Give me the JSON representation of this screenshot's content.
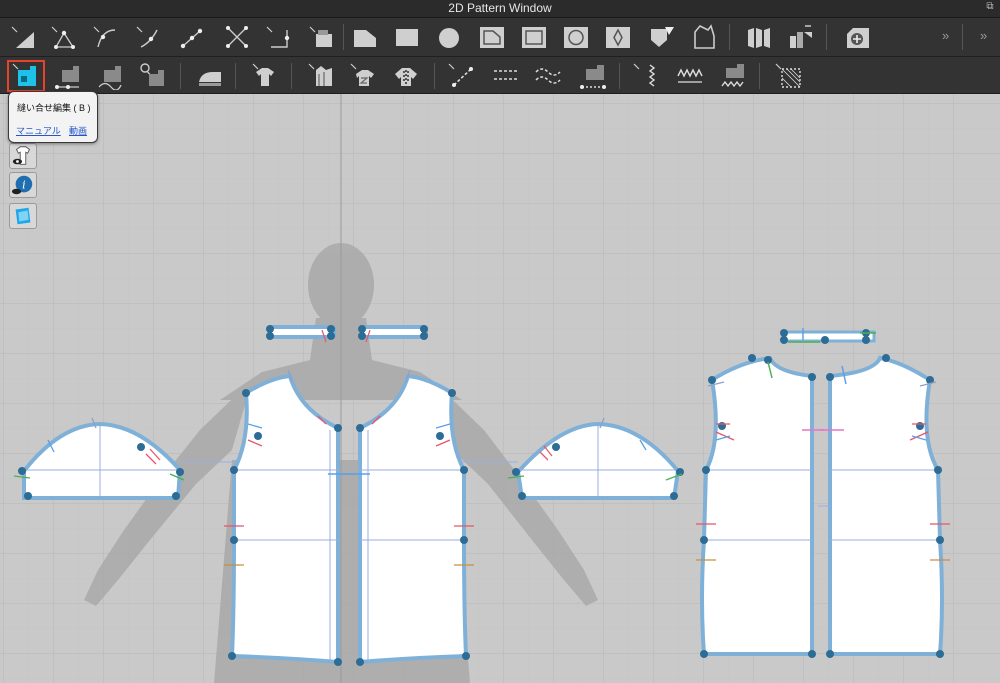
{
  "window": {
    "title": "2D Pattern Window"
  },
  "tooltip": {
    "title": "縫い合せ編集 ( B )",
    "link_manual": "マニュアル",
    "link_video": "動画"
  },
  "toolbar_row1": [
    "transform-pattern",
    "edit-point",
    "edit-curve-point",
    "curve-point",
    "add-point",
    "cut-sew",
    "center-point",
    "segment",
    "polygon",
    "rectangle",
    "circle",
    "internal-polygon",
    "internal-rectangle",
    "internal-circle",
    "internal-diamond",
    "dart",
    "trace",
    "unfold",
    "unfold-symmetric",
    "fold",
    "add-pattern"
  ],
  "toolbar_row2": [
    "edit-sewing",
    "segment-sewing",
    "free-sewing",
    "check-sewing",
    "steam",
    "tuck",
    "fold-arrangement",
    "pleat",
    "pleat-double",
    "topstitch",
    "segment-topstitch",
    "free-topstitch",
    "zipper",
    "elastic",
    "stitch-length",
    "puckering",
    "fabric-grain"
  ],
  "colors": {
    "pattern_outline": "#7fb0d8",
    "point": "#2d6c94",
    "active_tool": "#1ec2e8",
    "selection": "#e8412c"
  }
}
